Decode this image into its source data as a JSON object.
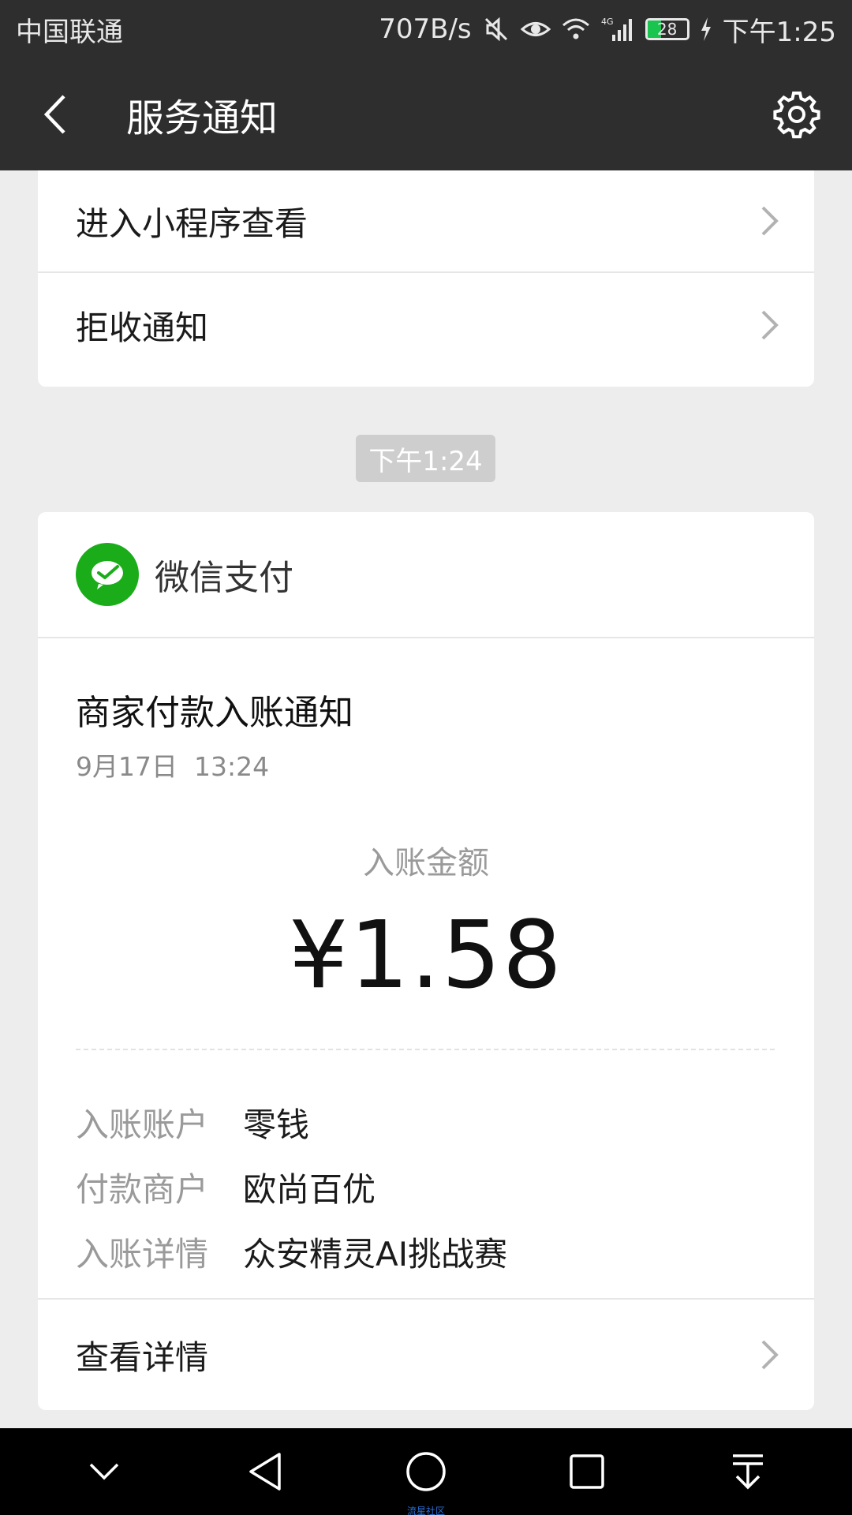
{
  "status_bar": {
    "carrier": "中国联通",
    "net_speed": "707B/s",
    "battery": "28",
    "time": "下午1:25"
  },
  "header": {
    "title": "服务通知"
  },
  "top_menu": {
    "items": [
      {
        "label": "进入小程序查看"
      },
      {
        "label": "拒收通知"
      }
    ]
  },
  "timestamp": "下午1:24",
  "notice": {
    "brand": "微信支付",
    "title": "商家付款入账通知",
    "date": "9月17日  13:24",
    "amount_label": "入账金额",
    "amount": "¥1.58",
    "info": [
      {
        "key": "入账账户",
        "value": "零钱"
      },
      {
        "key": "付款商户",
        "value": "欧尚百优"
      },
      {
        "key": "入账详情",
        "value": "众安精灵AI挑战赛"
      }
    ],
    "detail_label": "查看详情"
  },
  "watermark": "流星社区",
  "colors": {
    "header_bg": "#2e2e2e",
    "wepay_green": "#1aad19",
    "page_bg": "#ededed"
  }
}
